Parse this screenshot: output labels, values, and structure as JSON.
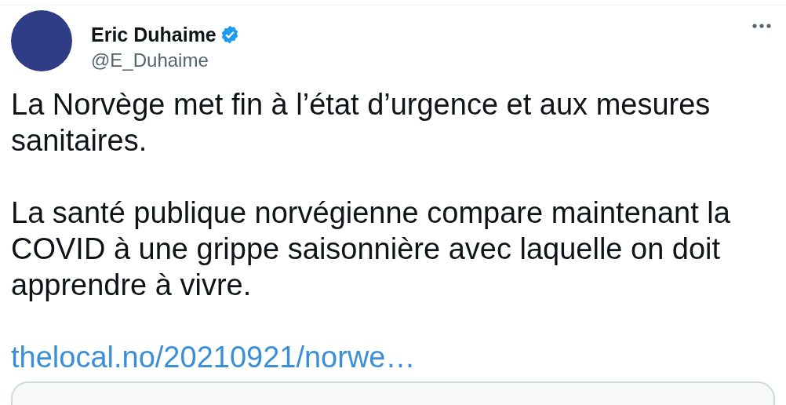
{
  "author": {
    "name": "Eric Duhaime",
    "verified": true,
    "handle": "@E_Duhaime"
  },
  "paragraphs": [
    "La Norvège met fin à l’état d’urgence et aux mesures sanitaires.",
    "La santé publique norvégienne compare maintenant la COVID à une grippe saisonnière avec laquelle on doit apprendre à vivre."
  ],
  "link": "thelocal.no/20210921/norwe…"
}
